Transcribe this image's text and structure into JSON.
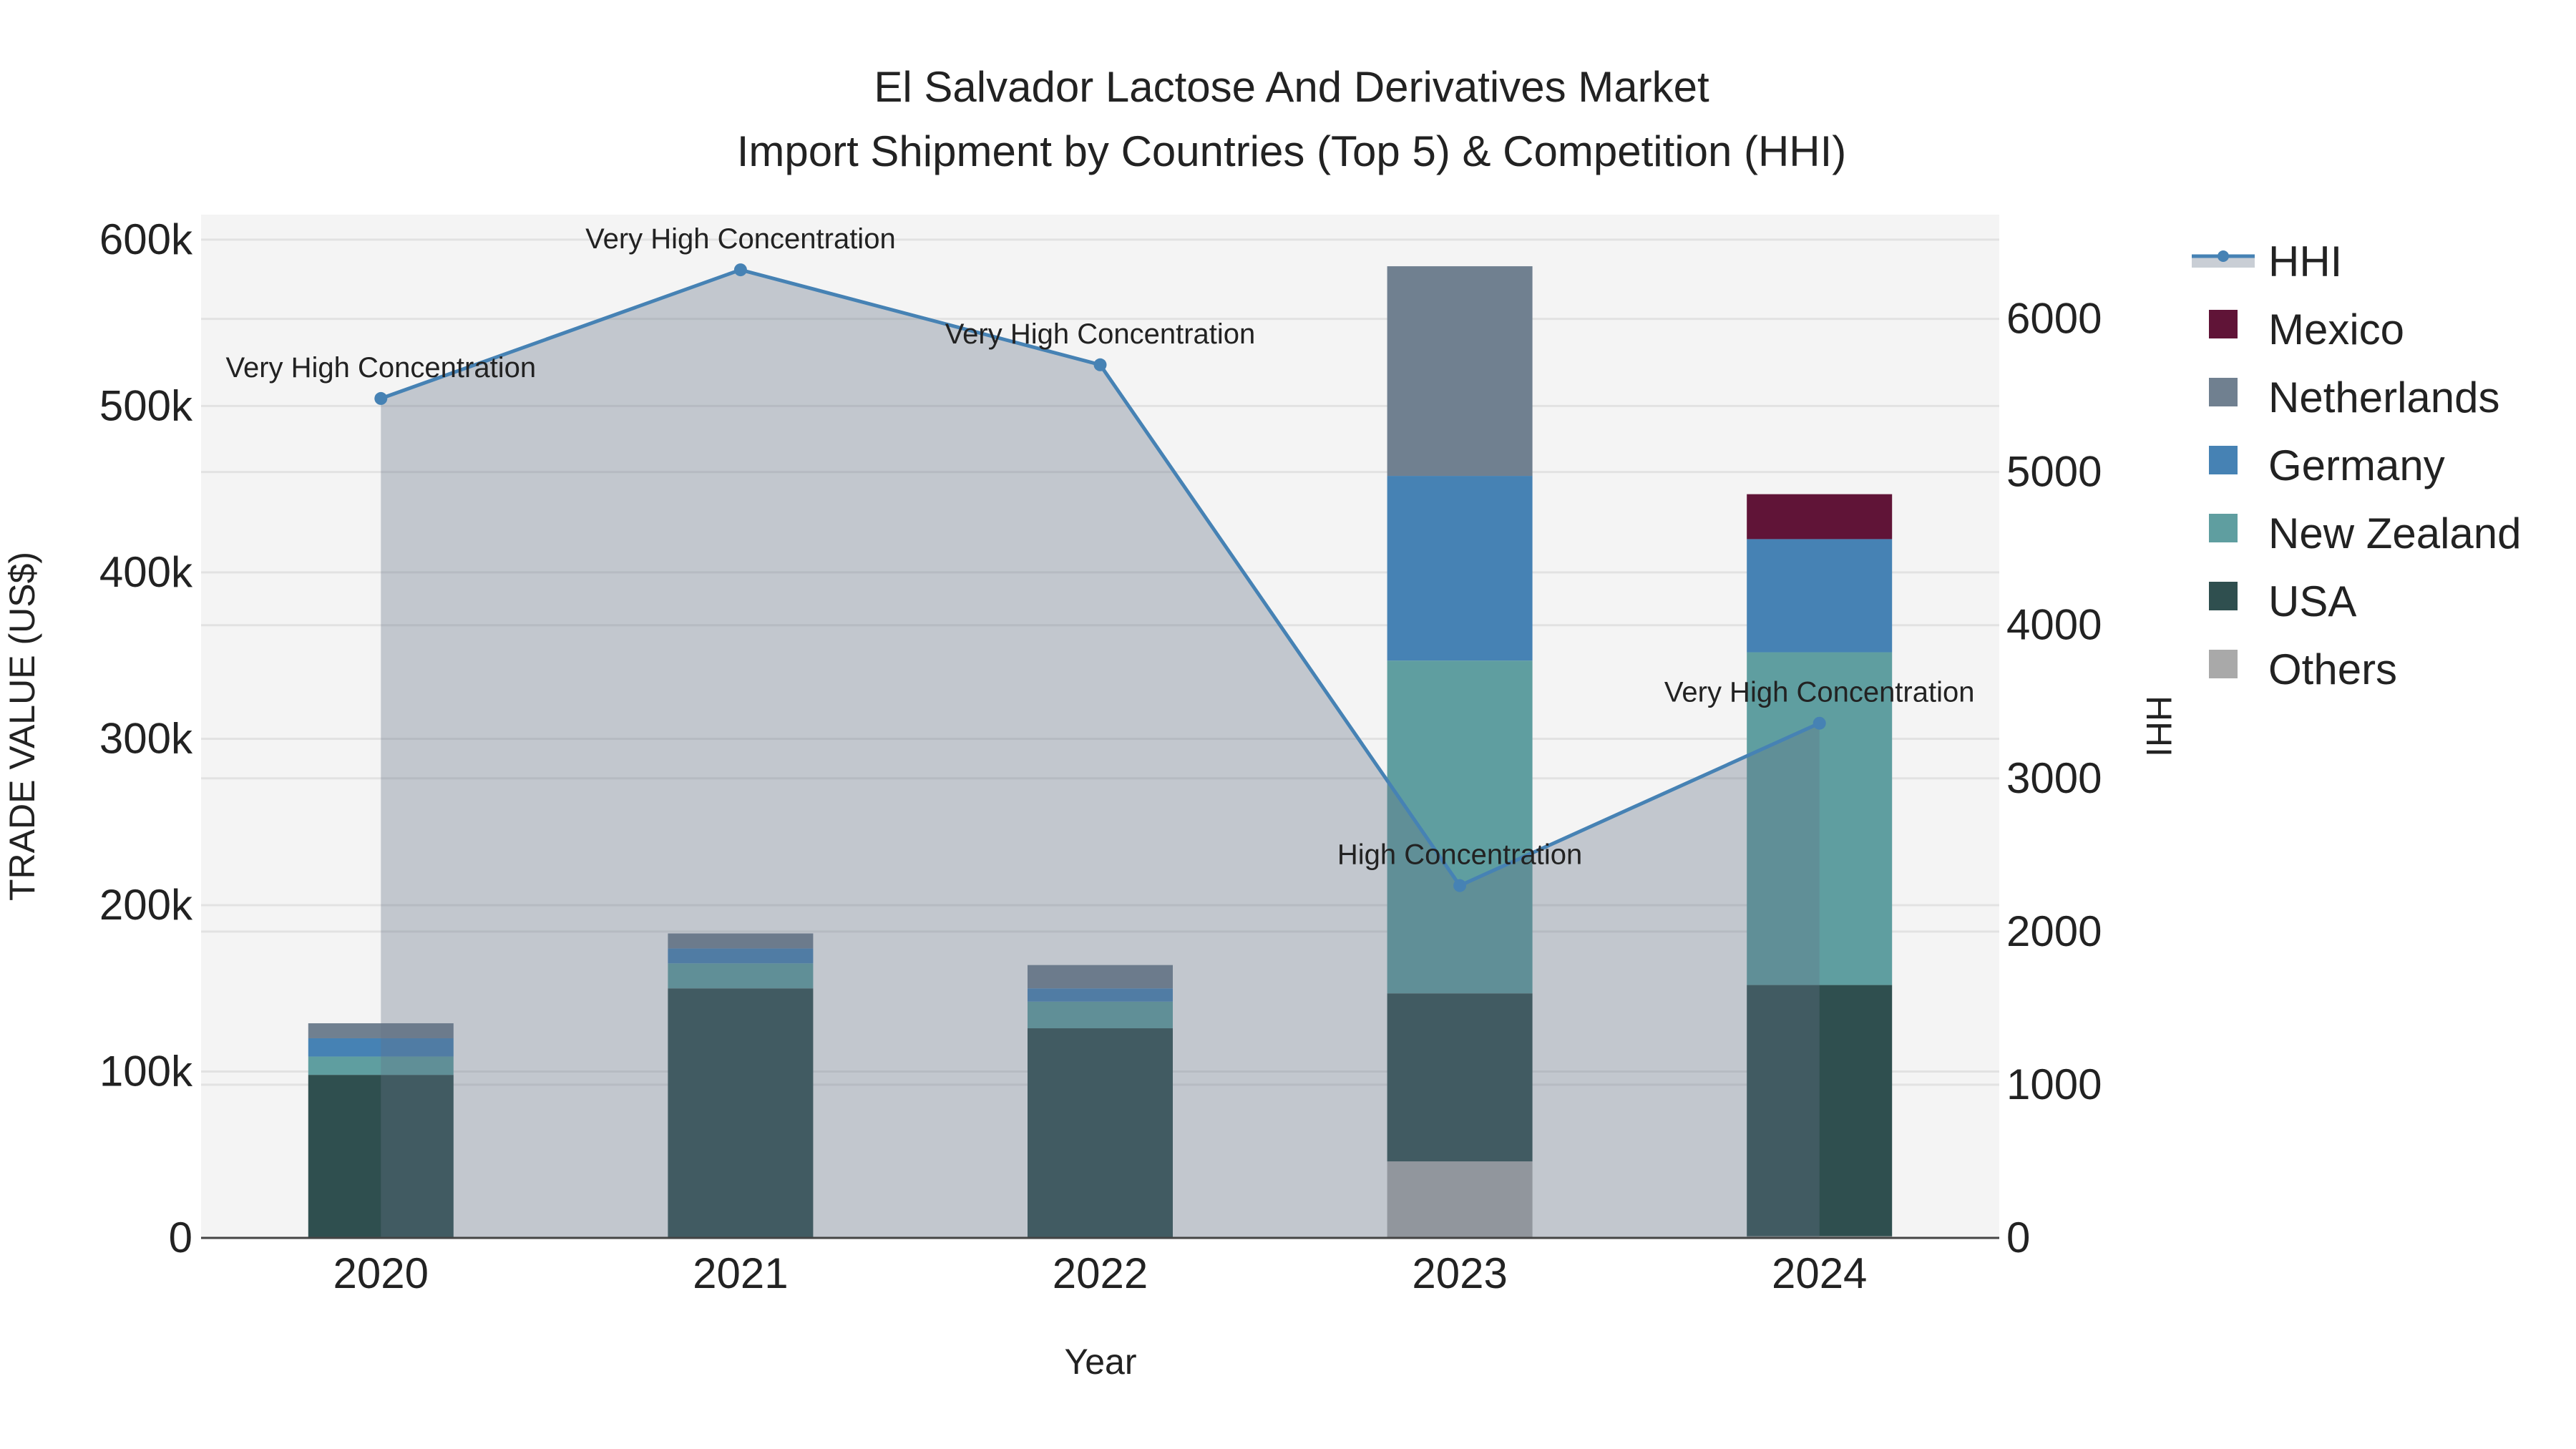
{
  "chart_data": {
    "type": "bar",
    "title_line1": "El Salvador Lactose And Derivatives Market",
    "title_line2": "Import Shipment by Countries (Top 5) & Competition (HHI)",
    "xlabel": "Year",
    "ylabel": "TRADE VALUE (US$)",
    "y2label": "HHI",
    "categories": [
      "2020",
      "2021",
      "2022",
      "2023",
      "2024"
    ],
    "ylim": [
      0,
      615000
    ],
    "y2lim": [
      0,
      6680
    ],
    "yticks": [
      0,
      100000,
      200000,
      300000,
      400000,
      500000,
      600000
    ],
    "ytick_labels": [
      "0",
      "100k",
      "200k",
      "300k",
      "400k",
      "500k",
      "600k"
    ],
    "y2ticks": [
      0,
      1000,
      2000,
      3000,
      4000,
      5000,
      6000
    ],
    "y2tick_labels": [
      "0",
      "1000",
      "2000",
      "3000",
      "4000",
      "5000",
      "6000"
    ],
    "grid": true,
    "legend_placement": "right",
    "series": [
      {
        "name": "Others",
        "color": "#a9a9a9",
        "values": [
          0,
          0,
          0,
          46000,
          1000
        ]
      },
      {
        "name": "USA",
        "color": "#2f4f4f",
        "values": [
          98000,
          150000,
          126000,
          101000,
          151000
        ]
      },
      {
        "name": "New Zealand",
        "color": "#5f9ea0",
        "values": [
          11000,
          15000,
          16000,
          200000,
          200000
        ]
      },
      {
        "name": "Germany",
        "color": "#4682b4",
        "values": [
          11000,
          9000,
          8000,
          111000,
          68000
        ]
      },
      {
        "name": "Netherlands",
        "color": "#708090",
        "values": [
          9000,
          9000,
          14000,
          126000,
          0
        ]
      },
      {
        "name": "Mexico",
        "color": "#601437",
        "values": [
          0,
          0,
          0,
          0,
          27000
        ]
      }
    ],
    "legend_order": [
      "HHI",
      "Mexico",
      "Netherlands",
      "Germany",
      "New Zealand",
      "USA",
      "Others"
    ],
    "hhi": {
      "name": "HHI",
      "color": "#4682b4",
      "values": [
        5480,
        6320,
        5700,
        2300,
        3360
      ],
      "annotations": [
        "Very High Concentration",
        "Very High Concentration",
        "Very High Concentration",
        "High Concentration",
        "Very High Concentration"
      ]
    }
  }
}
